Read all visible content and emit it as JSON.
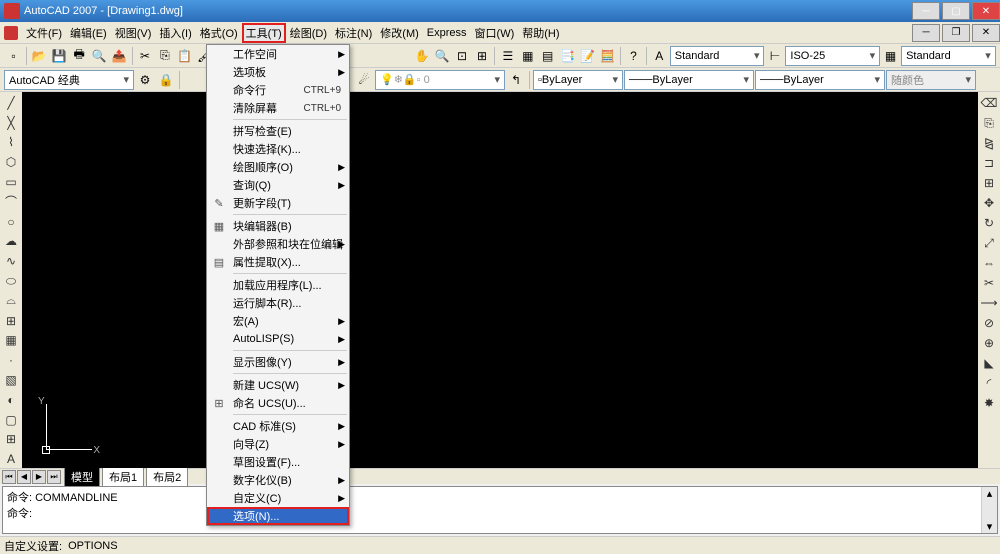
{
  "titlebar": {
    "text": "AutoCAD 2007 - [Drawing1.dwg]"
  },
  "menubar": {
    "items": [
      "文件(F)",
      "编辑(E)",
      "视图(V)",
      "插入(I)",
      "格式(O)",
      "工具(T)",
      "绘图(D)",
      "标注(N)",
      "修改(M)",
      "Express",
      "窗口(W)",
      "帮助(H)"
    ],
    "active_index": 5
  },
  "toolbar1": {
    "workspace_combo": "AutoCAD 经典",
    "style_combo": "Standard",
    "dim_combo": "ISO-25",
    "table_combo": "Standard"
  },
  "toolbar2": {
    "layer_combo": "",
    "color_combo": "ByLayer",
    "linetype_combo": "ByLayer",
    "lineweight_combo": "ByLayer",
    "plotstyle_combo": "随颜色"
  },
  "dropdown": {
    "groups": [
      [
        {
          "label": "工作空间",
          "submenu": true
        },
        {
          "label": "选项板",
          "submenu": true
        },
        {
          "label": "命令行",
          "shortcut": "CTRL+9"
        },
        {
          "label": "清除屏幕",
          "shortcut": "CTRL+0"
        }
      ],
      [
        {
          "label": "拼写检查(E)"
        },
        {
          "label": "快速选择(K)..."
        },
        {
          "label": "绘图顺序(O)",
          "submenu": true
        },
        {
          "label": "查询(Q)",
          "submenu": true
        },
        {
          "label": "更新字段(T)",
          "icon": "✎"
        }
      ],
      [
        {
          "label": "块编辑器(B)",
          "icon": "▦"
        },
        {
          "label": "外部参照和块在位编辑",
          "submenu": true
        },
        {
          "label": "属性提取(X)...",
          "icon": "▤"
        }
      ],
      [
        {
          "label": "加载应用程序(L)..."
        },
        {
          "label": "运行脚本(R)..."
        },
        {
          "label": "宏(A)",
          "submenu": true
        },
        {
          "label": "AutoLISP(S)",
          "submenu": true
        }
      ],
      [
        {
          "label": "显示图像(Y)",
          "submenu": true
        }
      ],
      [
        {
          "label": "新建 UCS(W)",
          "submenu": true
        },
        {
          "label": "命名 UCS(U)...",
          "icon": "⊞"
        }
      ],
      [
        {
          "label": "CAD 标准(S)",
          "submenu": true
        },
        {
          "label": "向导(Z)",
          "submenu": true
        },
        {
          "label": "草图设置(F)..."
        },
        {
          "label": "数字化仪(B)",
          "submenu": true
        },
        {
          "label": "自定义(C)",
          "submenu": true
        },
        {
          "label": "选项(N)...",
          "highlight": true
        }
      ]
    ]
  },
  "tabs": {
    "items": [
      "模型",
      "布局1",
      "布局2"
    ],
    "active": 0
  },
  "ucs": {
    "x": "X",
    "y": "Y"
  },
  "cmdline": {
    "line1": "命令: COMMANDLINE",
    "line2": "命令:"
  },
  "statusbar": {
    "label": "自定义设置:",
    "value": "OPTIONS"
  }
}
